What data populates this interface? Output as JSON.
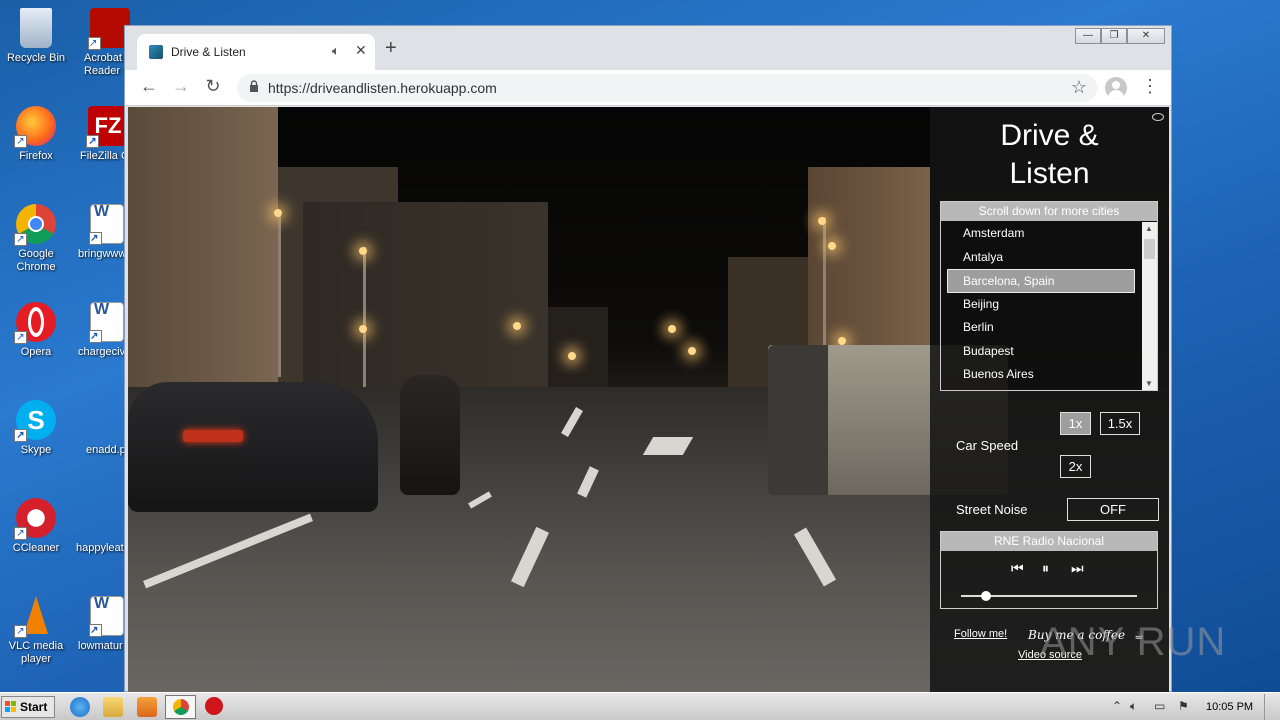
{
  "desktop": {
    "icons": [
      {
        "label": "Recycle Bin",
        "icon": "recycle-bin-icon"
      },
      {
        "label": "Acrobat Reader DC",
        "icon": "acrobat-icon"
      },
      {
        "label": "Firefox",
        "icon": "firefox-icon"
      },
      {
        "label": "FileZilla Client",
        "icon": "filezilla-icon"
      },
      {
        "label": "Google Chrome",
        "icon": "chrome-icon"
      },
      {
        "label": "bringwww",
        "icon": "word-doc-icon"
      },
      {
        "label": "Opera",
        "icon": "opera-icon"
      },
      {
        "label": "chargecivi",
        "icon": "word-doc-icon"
      },
      {
        "label": "Skype",
        "icon": "skype-icon"
      },
      {
        "label": "enadd.p",
        "icon": "blank-file-icon"
      },
      {
        "label": "CCleaner",
        "icon": "ccleaner-icon"
      },
      {
        "label": "happyleat",
        "icon": "blank-file-icon"
      },
      {
        "label": "VLC media player",
        "icon": "vlc-icon"
      },
      {
        "label": "lowmatur",
        "icon": "word-doc-icon"
      }
    ]
  },
  "browser": {
    "tab_title": "Drive & Listen",
    "tab_close": "✕",
    "new_tab": "+",
    "url": "https://driveandlisten.herokuapp.com",
    "win_controls": {
      "minimize": "—",
      "restore": "❐",
      "close": "✕"
    }
  },
  "app": {
    "title": "Drive & Listen",
    "city_header": "Scroll down for more cities",
    "cities": [
      "Amsterdam",
      "Antalya",
      "Barcelona, Spain",
      "Beijing",
      "Berlin",
      "Budapest",
      "Buenos Aires"
    ],
    "selected_city": "Barcelona, Spain",
    "speed_label": "Car Speed",
    "speed_options": [
      "1x",
      "1.5x",
      "2x"
    ],
    "speed_selected": "1x",
    "noise_label": "Street Noise",
    "noise_value": "OFF",
    "radio_name": "RNE Radio Nacional",
    "volume_fraction": 0.12,
    "follow_link": "Follow me!",
    "coffee_link": "Buy me a coffee",
    "video_source": "Video source"
  },
  "watermark": {
    "text": "ANY RUN"
  },
  "taskbar": {
    "start_label": "Start",
    "clock": "10:05 PM"
  },
  "colors": {
    "accent": "#9e9e9e",
    "desktop_blue": "#1e63b5"
  }
}
